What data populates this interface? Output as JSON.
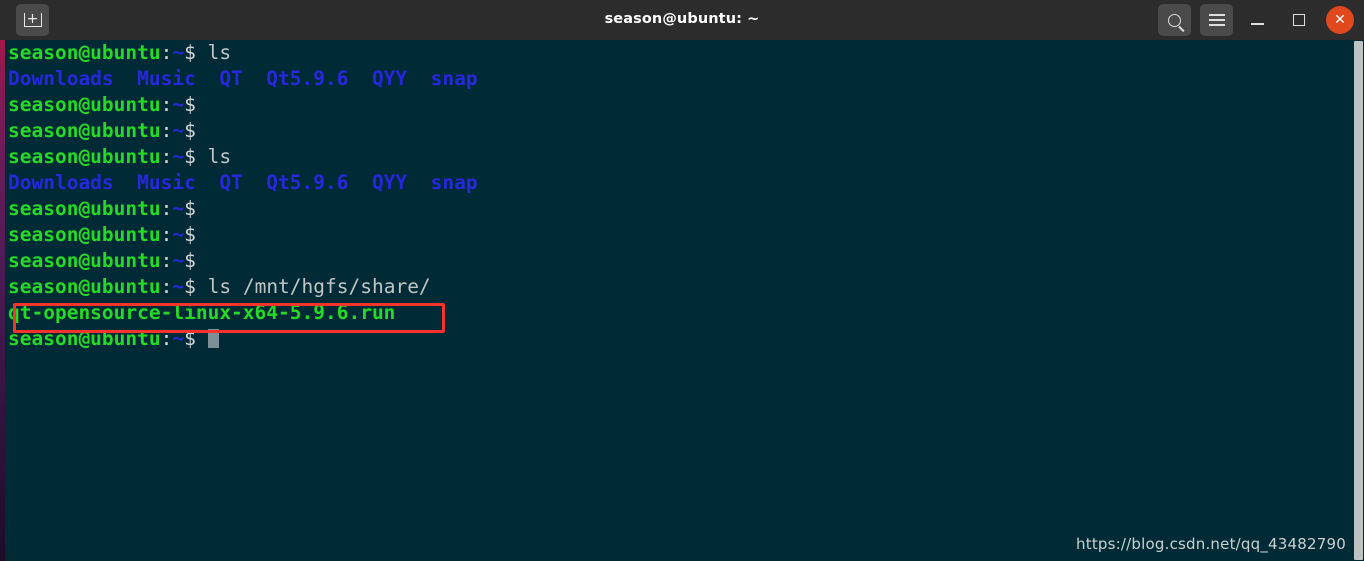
{
  "window": {
    "title": "season@ubuntu: ~",
    "background_color": "#002b36",
    "titlebar_color": "#2c2c2c"
  },
  "titlebar": {
    "new_tab_label": "+",
    "search_icon": "search-icon",
    "menu_icon": "hamburger-menu-icon",
    "minimize_icon": "minimize-icon",
    "maximize_icon": "maximize-icon",
    "close_icon": "close-icon",
    "close_color": "#e0481e"
  },
  "terminal": {
    "prompt_user": "season@ubuntu",
    "prompt_colon": ":",
    "prompt_path": "~",
    "prompt_dollar": "$",
    "prompt_color": "#26d926",
    "dir_color": "#2727dd",
    "exec_color": "#26d926",
    "command_color": "#c2c5c5",
    "lines": [
      {
        "type": "prompt",
        "command": " ls"
      },
      {
        "type": "dirlist",
        "text": "Downloads  Music  QT  Qt5.9.6  QYY  snap"
      },
      {
        "type": "prompt",
        "command": ""
      },
      {
        "type": "prompt",
        "command": ""
      },
      {
        "type": "prompt",
        "command": " ls"
      },
      {
        "type": "dirlist",
        "text": "Downloads  Music  QT  Qt5.9.6  QYY  snap"
      },
      {
        "type": "prompt",
        "command": ""
      },
      {
        "type": "prompt",
        "command": ""
      },
      {
        "type": "prompt",
        "command": ""
      },
      {
        "type": "prompt",
        "command": " ls /mnt/hgfs/share/"
      },
      {
        "type": "exec",
        "text": "qt-opensource-linux-x64-5.9.6.run"
      },
      {
        "type": "prompt_cursor",
        "command": " "
      }
    ]
  },
  "annotation": {
    "box_color": "#f4342c",
    "highlighted_text": "qt-opensource-linux-x64-5.9.6.run"
  },
  "watermark": {
    "text": "https://blog.csdn.net/qq_43482790"
  }
}
